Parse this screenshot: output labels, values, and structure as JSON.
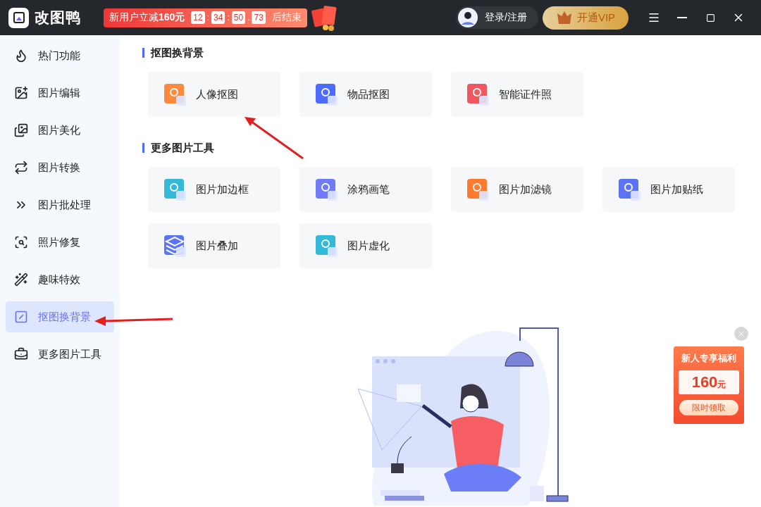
{
  "app": {
    "title": "改图鸭"
  },
  "promo": {
    "text": "新用户立减**160元**",
    "countdown": [
      {
        "kind": "digit",
        "text": "12"
      },
      {
        "kind": "sep",
        "text": ":"
      },
      {
        "kind": "digit",
        "text": "34"
      },
      {
        "kind": "sep",
        "text": ":"
      },
      {
        "kind": "digit",
        "text": "50"
      },
      {
        "kind": "sep",
        "text": "."
      },
      {
        "kind": "digit",
        "text": "73"
      }
    ],
    "suffix": "后结束"
  },
  "user": {
    "label": "登录/注册"
  },
  "vip": {
    "label": "开通VIP"
  },
  "sidebar": {
    "items": [
      {
        "kind": "hot",
        "label": "热门功能",
        "selected": false
      },
      {
        "kind": "edit",
        "label": "图片编辑",
        "selected": false
      },
      {
        "kind": "beauty",
        "label": "图片美化",
        "selected": false
      },
      {
        "kind": "convert",
        "label": "图片转换",
        "selected": false
      },
      {
        "kind": "batch",
        "label": "图片批处理",
        "selected": false
      },
      {
        "kind": "repair",
        "label": "照片修复",
        "selected": false
      },
      {
        "kind": "fun",
        "label": "趣味特效",
        "selected": false
      },
      {
        "kind": "cutout",
        "label": "抠图换背景",
        "selected": true
      },
      {
        "kind": "tools",
        "label": "更多图片工具",
        "selected": false
      }
    ]
  },
  "sections": [
    {
      "title": "抠图换背景",
      "tools": [
        {
          "kind": "portrait",
          "label": "人像抠图"
        },
        {
          "kind": "object",
          "label": "物品抠图"
        },
        {
          "kind": "idphoto",
          "label": "智能证件照"
        }
      ]
    },
    {
      "title": "更多图片工具",
      "tools": [
        {
          "kind": "border",
          "label": "图片加边框"
        },
        {
          "kind": "brush",
          "label": "涂鸦画笔"
        },
        {
          "kind": "filter",
          "label": "图片加滤镜"
        },
        {
          "kind": "sticker",
          "label": "图片加贴纸"
        },
        {
          "kind": "layers",
          "label": "图片叠加"
        },
        {
          "kind": "blur",
          "label": "图片虚化"
        }
      ]
    }
  ],
  "offer": {
    "title": "新人专享福利",
    "amount": "160",
    "unit": "元",
    "button": "限时领取"
  }
}
